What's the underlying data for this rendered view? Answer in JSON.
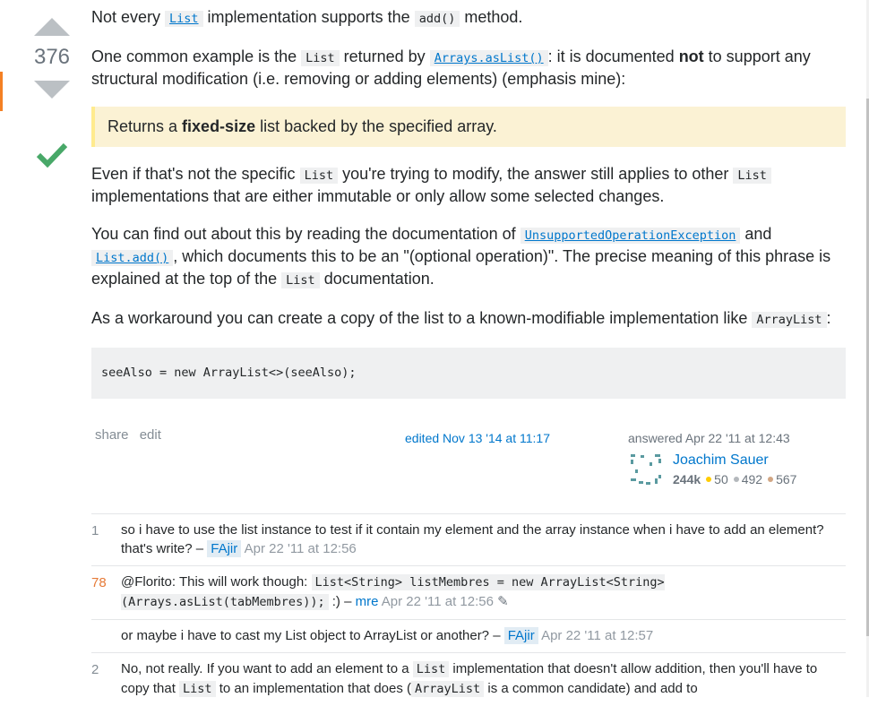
{
  "vote": {
    "count": "376"
  },
  "post": {
    "p1": {
      "a": "Not every ",
      "code1": "List",
      "b": " implementation supports the ",
      "code2": "add()",
      "c": " method."
    },
    "p2": {
      "a": "One common example is the ",
      "code1": "List",
      "b": " returned by ",
      "link": "Arrays.asList()",
      "c": ": it is documented ",
      "strong": "not",
      "d": " to support any structural modification (i.e. removing or adding elements) (emphasis mine):"
    },
    "quote": {
      "a": "Returns a ",
      "strong": "fixed-size",
      "b": " list backed by the specified array."
    },
    "p3": {
      "a": "Even if that's not the specific ",
      "code1": "List",
      "b": " you're trying to modify, the answer still applies to other ",
      "code2": "List",
      "c": " implementations that are either immutable or only allow some selected changes."
    },
    "p4": {
      "a": "You can find out about this by reading the documentation of ",
      "link1": "UnsupportedOperationException",
      "b": " and ",
      "link2": "List.add()",
      "c": ", which documents this to be an \"(optional operation)\". The precise meaning of this phrase is explained at the top of the ",
      "code1": "List",
      "d": " documentation."
    },
    "p5": {
      "a": "As a workaround you can create a copy of the list to a known-modifiable implementation like ",
      "code1": "ArrayList",
      "b": ":"
    },
    "code_block": "seeAlso = new ArrayList<>(seeAlso);"
  },
  "menu": {
    "share": "share",
    "edit": "edit"
  },
  "edited": "edited Nov 13 '14 at 11:17",
  "answered": "answered Apr 22 '11 at 12:43",
  "user": {
    "name": "Joachim Sauer",
    "rep": "244k",
    "gold": "50",
    "silver": "492",
    "bronze": "567",
    "gold_color": "#ffcc01",
    "silver_color": "#b4b8bc",
    "bronze_color": "#d1a684"
  },
  "comments": [
    {
      "score": "1",
      "text": "so i have to use the list instance to test if it contain my element and the array instance when i have to add an element? that's write? – ",
      "user": "FAjir",
      "date": "Apr 22 '11 at 12:56"
    },
    {
      "score": "78",
      "text_a": "@Florito: This will work though: ",
      "code": "List<String> listMembres = new ArrayList<String>(Arrays.asList(tabMembres));",
      "text_b": " :) – ",
      "user": "mre",
      "date": "Apr 22 '11 at 12:56"
    },
    {
      "score": "",
      "text": "or maybe i have to cast my List object to ArrayList or another? – ",
      "user": "FAjir",
      "date": "Apr 22 '11 at 12:57"
    },
    {
      "score": "2",
      "text_a": "No, not really. If you want to add an element to a ",
      "code1": "List",
      "text_b": " implementation that doesn't allow addition, then you'll have to copy that ",
      "code2": "List",
      "text_c": " to an implementation that does (",
      "code3": "ArrayList",
      "text_d": " is a common candidate) and add to"
    }
  ]
}
